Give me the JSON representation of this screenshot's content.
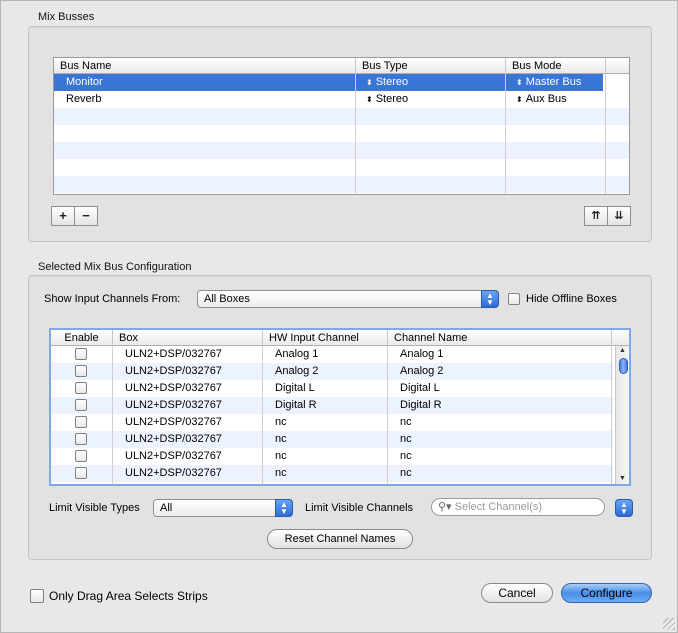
{
  "mix_busses": {
    "title": "Mix Busses",
    "columns": [
      "Bus Name",
      "Bus Type",
      "Bus Mode"
    ],
    "rows": [
      {
        "name": "Monitor",
        "type": "Stereo",
        "mode": "Master Bus",
        "selected": true
      },
      {
        "name": "Reverb",
        "type": "Stereo",
        "mode": "Aux Bus",
        "selected": false
      }
    ],
    "add_label": "+",
    "remove_label": "−",
    "move_up_label": "⇈",
    "move_down_label": "⇊"
  },
  "config": {
    "title": "Selected Mix Bus Configuration",
    "show_from_label": "Show Input Channels From:",
    "show_from_value": "All Boxes",
    "hide_offline_label": "Hide Offline Boxes",
    "columns": [
      "Enable",
      "Box",
      "HW Input Channel",
      "Channel Name"
    ],
    "rows": [
      {
        "box": "ULN2+DSP/032767",
        "hw": "Analog 1",
        "name": "Analog 1"
      },
      {
        "box": "ULN2+DSP/032767",
        "hw": "Analog 2",
        "name": "Analog 2"
      },
      {
        "box": "ULN2+DSP/032767",
        "hw": "Digital L",
        "name": "Digital L"
      },
      {
        "box": "ULN2+DSP/032767",
        "hw": "Digital R",
        "name": "Digital R"
      },
      {
        "box": "ULN2+DSP/032767",
        "hw": "nc",
        "name": "nc"
      },
      {
        "box": "ULN2+DSP/032767",
        "hw": "nc",
        "name": "nc"
      },
      {
        "box": "ULN2+DSP/032767",
        "hw": "nc",
        "name": "nc"
      },
      {
        "box": "ULN2+DSP/032767",
        "hw": "nc",
        "name": "nc"
      }
    ],
    "limit_types_label": "Limit Visible Types",
    "limit_types_value": "All",
    "limit_channels_label": "Limit Visible Channels",
    "search_placeholder": "Select Channel(s)",
    "reset_label": "Reset Channel Names"
  },
  "footer": {
    "drag_label": "Only Drag Area Selects Strips",
    "cancel_label": "Cancel",
    "configure_label": "Configure"
  },
  "colors": {
    "selection": "#3875d7",
    "alt_row": "#edf3fe",
    "default_button": "#4a8fe7"
  }
}
